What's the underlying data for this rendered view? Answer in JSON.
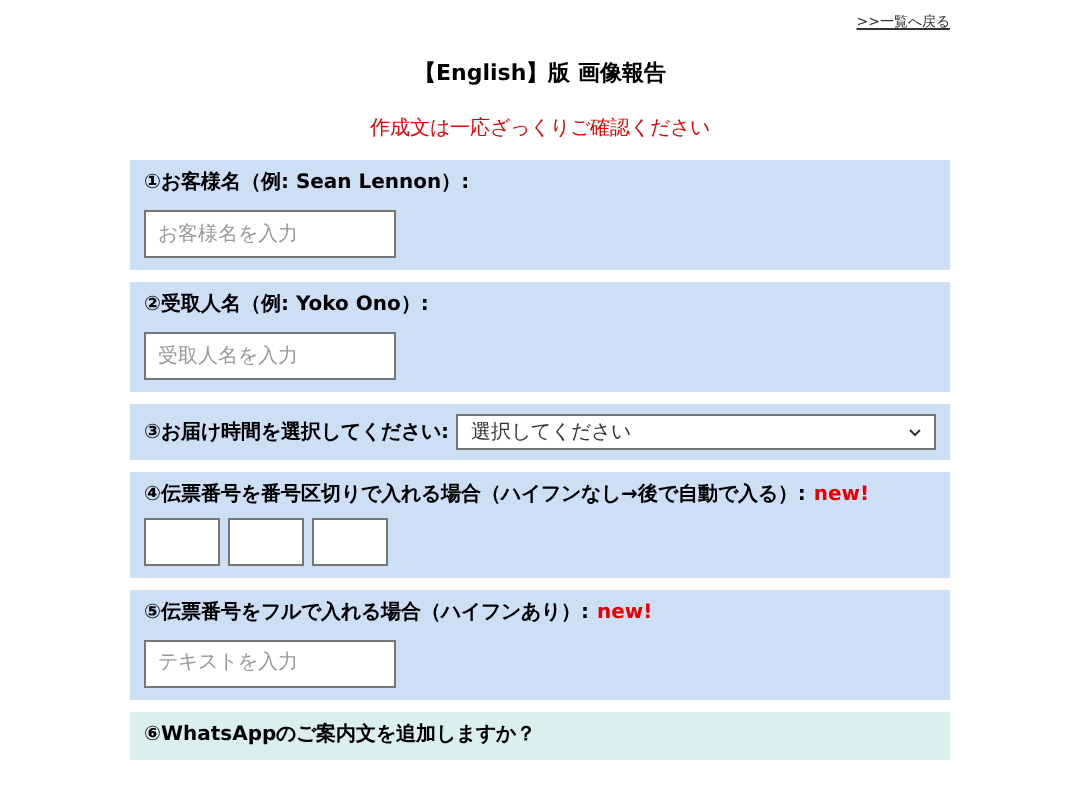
{
  "back_link": ">>一覧へ戻る",
  "title": "【English】版 画像報告",
  "notice": "作成文は一応ざっくりご確認ください",
  "sections": [
    {
      "kind": "text",
      "label": "①お客様名（例: Sean Lennon）:",
      "placeholder": "お客様名を入力"
    },
    {
      "kind": "text",
      "label": "②受取人名（例: Yoko Ono）:",
      "placeholder": "受取人名を入力"
    },
    {
      "kind": "select",
      "label": "③お届け時間を選択してください:",
      "value": "選択してください"
    },
    {
      "kind": "split",
      "label": "④伝票番号を番号区切りで入れる場合（ハイフンなし→後で自動で入る）:",
      "badge": "new!"
    },
    {
      "kind": "text",
      "label": "⑤伝票番号をフルで入れる場合（ハイフンあり）:",
      "badge": "new!",
      "placeholder": "テキストを入力"
    },
    {
      "kind": "question",
      "label": "⑥WhatsAppのご案内文を追加しますか？"
    }
  ]
}
